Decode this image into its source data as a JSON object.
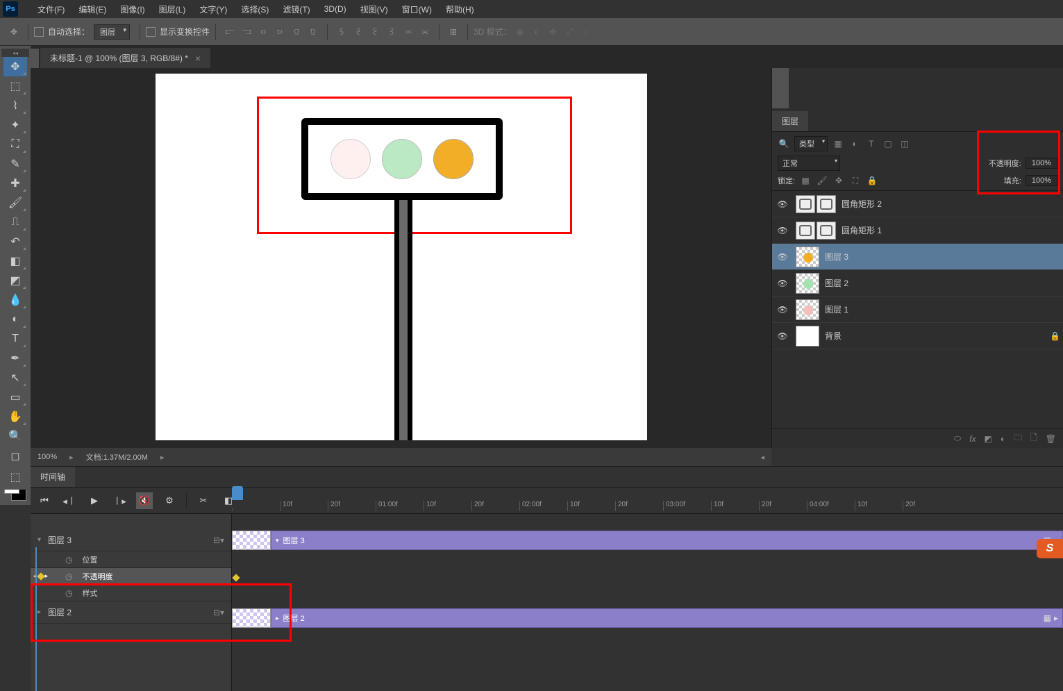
{
  "app": {
    "logo": "Ps"
  },
  "menu": [
    "文件(F)",
    "编辑(E)",
    "图像(I)",
    "图层(L)",
    "文字(Y)",
    "选择(S)",
    "滤镜(T)",
    "3D(D)",
    "视图(V)",
    "窗口(W)",
    "帮助(H)"
  ],
  "options": {
    "autoSelectLabel": "自动选择：",
    "autoSelectTarget": "图层",
    "showTransformLabel": "显示变换控件",
    "mode3d": "3D 模式："
  },
  "doc": {
    "tab": "未标题-1 @ 100% (图层 3, RGB/8#) *"
  },
  "status": {
    "zoom": "100%",
    "docsize": "文档:1.37M/2.00M"
  },
  "layersPanel": {
    "tab": "图层",
    "filterLabel": "类型",
    "blendMode": "正常",
    "opacityLabel": "不透明度:",
    "opacityValue": "100%",
    "lockLabel": "锁定:",
    "fillLabel": "填充:",
    "fillValue": "100%",
    "layers": [
      {
        "name": "圆角矩形 2",
        "type": "rect"
      },
      {
        "name": "圆角矩形 1",
        "type": "rect"
      },
      {
        "name": "图层 3",
        "type": "orange",
        "selected": true
      },
      {
        "name": "图层 2",
        "type": "green"
      },
      {
        "name": "图层 1",
        "type": "red"
      },
      {
        "name": "背景",
        "type": "bg"
      }
    ]
  },
  "timeline": {
    "tab": "时间轴",
    "ruler": [
      "10f",
      "20f",
      "01:00f",
      "10f",
      "20f",
      "02:00f",
      "10f",
      "20f",
      "03:00f",
      "10f",
      "20f",
      "04:00f",
      "10f",
      "20f"
    ],
    "tracks": [
      {
        "name": "图层 3",
        "selected": true,
        "clipLabel": "图层 3",
        "props": [
          {
            "name": "位置"
          },
          {
            "name": "不透明度",
            "selected": true,
            "keyframes": true
          },
          {
            "name": "样式"
          }
        ]
      },
      {
        "name": "图层 2",
        "clipLabel": "图层 2"
      }
    ]
  },
  "badgeLetter": "S"
}
